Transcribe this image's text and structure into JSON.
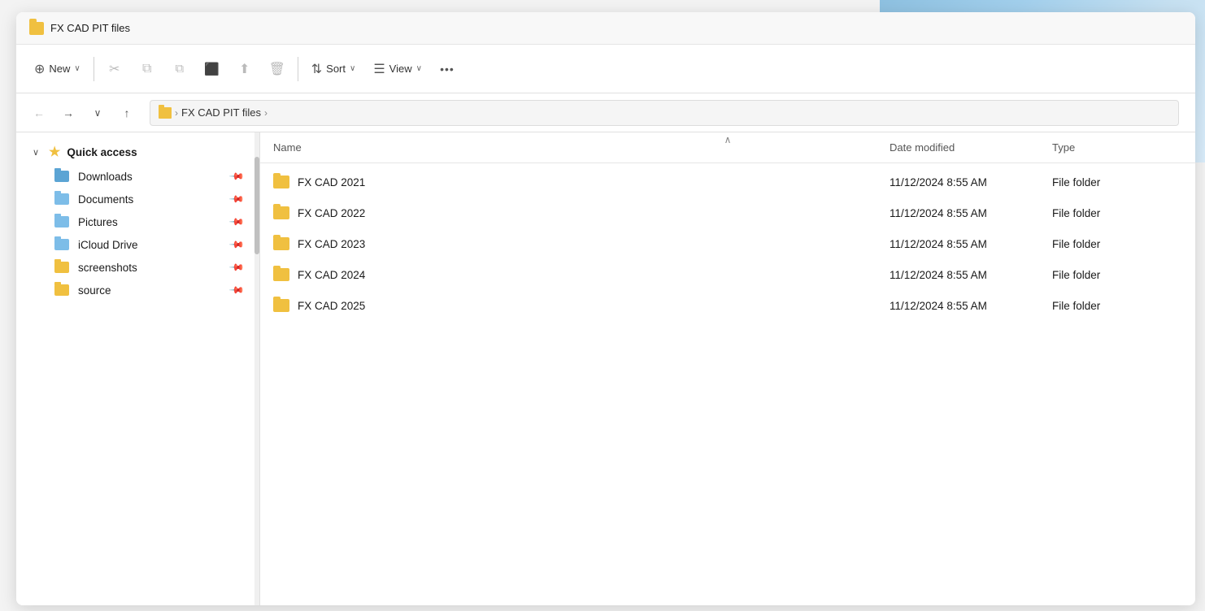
{
  "background": {
    "gradient_colors": [
      "#4a9fd4",
      "#6db8e8",
      "#a8d4f0"
    ]
  },
  "window": {
    "title": "FX CAD PIT files",
    "title_folder_color": "#f0c040"
  },
  "toolbar": {
    "new_label": "New",
    "sort_label": "Sort",
    "view_label": "View",
    "new_icon": "➕",
    "cut_icon": "✂",
    "copy_icon": "⧉",
    "paste_icon": "📋",
    "rename_icon": "⧉",
    "share_icon": "⬆",
    "delete_icon": "🗑",
    "sort_icon": "⇅",
    "view_icon": "≡",
    "more_icon": "···"
  },
  "navigation": {
    "back_enabled": false,
    "forward_enabled": true,
    "recent_enabled": true,
    "up_enabled": true,
    "breadcrumb": [
      {
        "label": "FX CAD PIT files",
        "is_folder": true
      }
    ]
  },
  "sidebar": {
    "quick_access_label": "Quick access",
    "items": [
      {
        "label": "Downloads",
        "icon_type": "folder-blue",
        "pinned": true
      },
      {
        "label": "Documents",
        "icon_type": "folder-blue-light",
        "pinned": true
      },
      {
        "label": "Pictures",
        "icon_type": "folder-blue-light",
        "pinned": true
      },
      {
        "label": "iCloud Drive",
        "icon_type": "icloud",
        "pinned": true
      },
      {
        "label": "screenshots",
        "icon_type": "folder-yellow",
        "pinned": true
      },
      {
        "label": "source",
        "icon_type": "folder-yellow",
        "pinned": true
      }
    ]
  },
  "file_list": {
    "columns": {
      "name": "Name",
      "date_modified": "Date modified",
      "type": "Type"
    },
    "files": [
      {
        "name": "FX CAD 2021",
        "date_modified": "11/12/2024 8:55 AM",
        "type": "File folder"
      },
      {
        "name": "FX CAD 2022",
        "date_modified": "11/12/2024 8:55 AM",
        "type": "File folder"
      },
      {
        "name": "FX CAD 2023",
        "date_modified": "11/12/2024 8:55 AM",
        "type": "File folder"
      },
      {
        "name": "FX CAD 2024",
        "date_modified": "11/12/2024 8:55 AM",
        "type": "File folder"
      },
      {
        "name": "FX CAD 2025",
        "date_modified": "11/12/2024 8:55 AM",
        "type": "File folder"
      }
    ]
  }
}
